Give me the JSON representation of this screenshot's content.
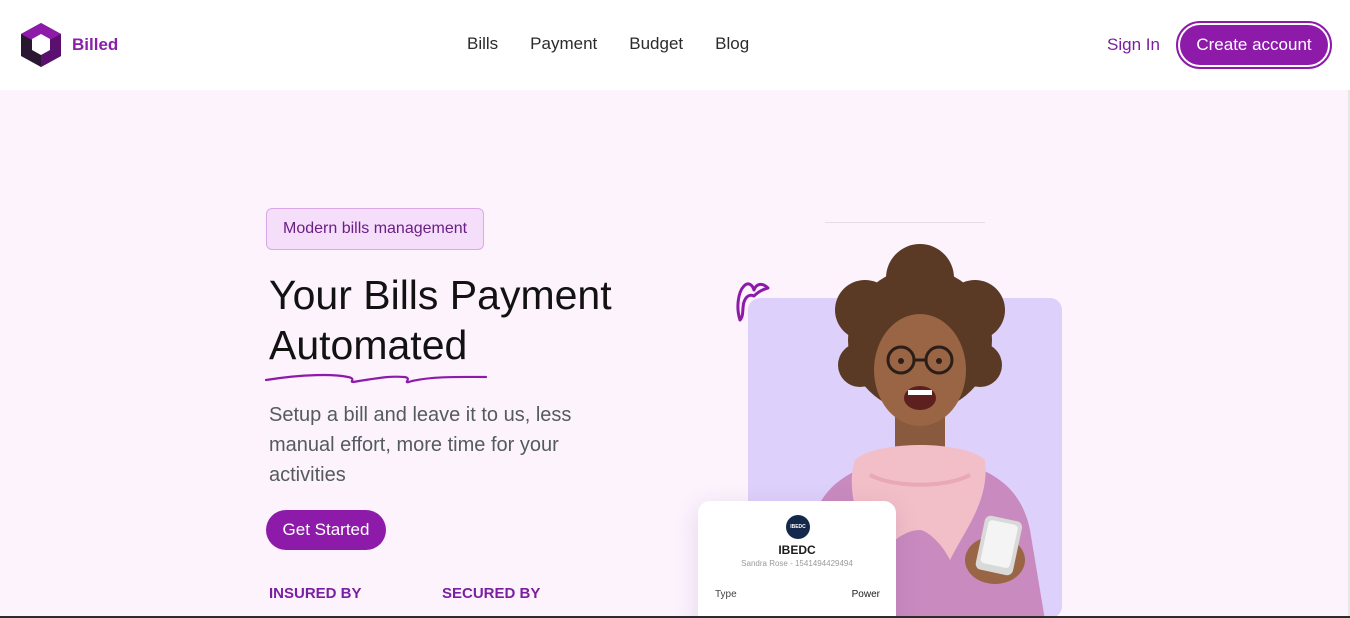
{
  "brand": {
    "name": "Billed",
    "color": "#8d1aa9"
  },
  "nav": {
    "links": [
      "Bills",
      "Payment",
      "Budget",
      "Blog"
    ]
  },
  "auth": {
    "sign_in": "Sign In",
    "create_account": "Create account"
  },
  "hero": {
    "tag": "Modern bills management",
    "headline_line1": "Your Bills Payment",
    "headline_line2": "Automated",
    "subtitle": "Setup a bill and leave it to us, less manual effort, more time for your activities",
    "cta": "Get Started",
    "insured_by": "INSURED BY",
    "secured_by": "SECURED BY"
  },
  "bill_card": {
    "provider": "IBEDC",
    "logo_text": "IBEDC",
    "customer": "Sandra Rose - 1541494429494",
    "type_label": "Type",
    "type_value": "Power"
  },
  "colors": {
    "hero_bg": "#fcf3fd",
    "photo_bg": "#ddd1fb",
    "accent": "#8d1aa9"
  }
}
